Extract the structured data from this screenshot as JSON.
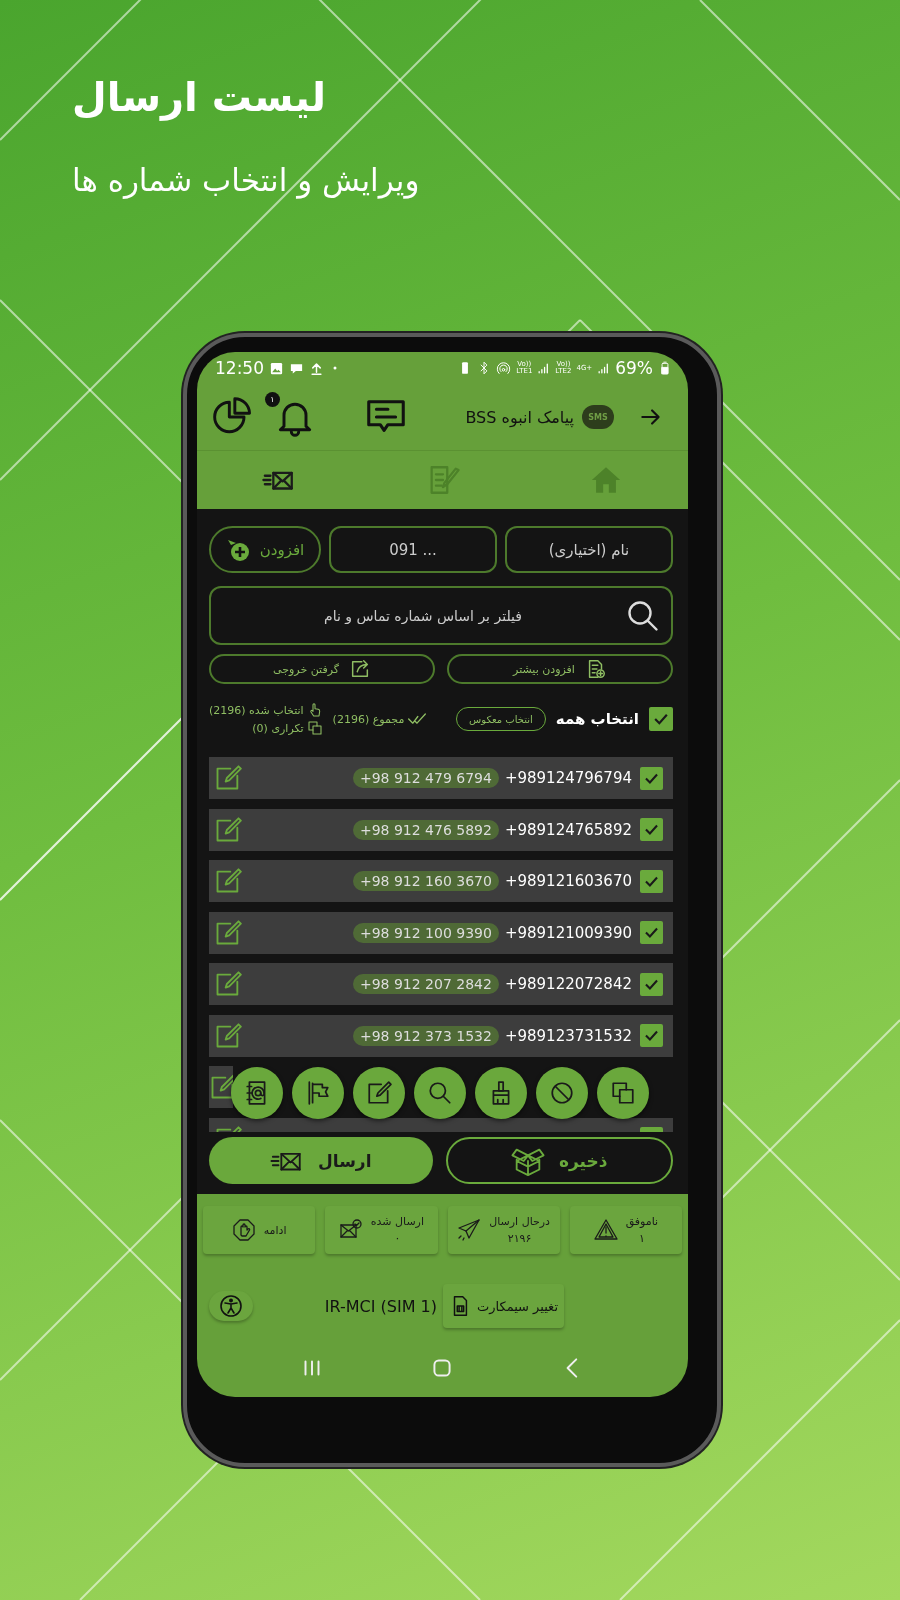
{
  "promo": {
    "title": "لیست ارسال",
    "subtitle": "ویرایش و انتخاب شماره ها"
  },
  "status_bar": {
    "time": "12:50",
    "battery": "69%",
    "sim1": {
      "volte": "Vo))",
      "label": "LTE1"
    },
    "sim2": {
      "volte": "Vo))",
      "label": "LTE2",
      "network": "4G+"
    }
  },
  "app_bar": {
    "title": "پیامک انبوه BSS",
    "logo": "SMS",
    "notification_count": "۱"
  },
  "tabs": [
    {
      "selected": false
    },
    {
      "selected": false
    },
    {
      "selected": true
    }
  ],
  "form": {
    "name_placeholder": "نام (اختیاری)",
    "number_placeholder": "091 ...",
    "add_button": "افزودن",
    "filter_placeholder": "فیلتر بر اساس شماره تماس و نام",
    "add_more_button": "افزودن بیشتر",
    "export_button": "گرفتن خروجی"
  },
  "selection": {
    "select_all": "انتخاب همه",
    "all_checked": true,
    "invert_button": "انتخاب معکوس",
    "total": "مجموع (2196)",
    "selected_count": "انتخاب شده (2196)",
    "duplicates": "تکراری (0)"
  },
  "numbers": [
    {
      "kind": "full",
      "number": "+989124796794",
      "formatted": "+98 912 479 6794",
      "checked": true
    },
    {
      "kind": "full",
      "number": "+989124765892",
      "formatted": "+98 912 476 5892",
      "checked": true
    },
    {
      "kind": "full",
      "number": "+989121603670",
      "formatted": "+98 912 160 3670",
      "checked": true
    },
    {
      "kind": "full",
      "number": "+989121009390",
      "formatted": "+98 912 100 9390",
      "checked": true
    },
    {
      "kind": "full",
      "number": "+989122072842",
      "formatted": "+98 912 207 2842",
      "checked": true
    },
    {
      "kind": "full",
      "number": "+989123731532",
      "formatted": "+98 912 373 1532",
      "checked": true
    },
    {
      "kind": "covered"
    },
    {
      "kind": "cut",
      "checked": true
    }
  ],
  "actions": {
    "send": "ارسال",
    "save": "ذخیره"
  },
  "stats": [
    {
      "kind": "failed",
      "label": "ناموفق",
      "value": "۱"
    },
    {
      "kind": "sending",
      "label": "درحال ارسال",
      "value": "۲۱۹۶"
    },
    {
      "kind": "sent",
      "label": "ارسال شده",
      "value": "۰"
    },
    {
      "kind": "resume",
      "label": "ادامه"
    }
  ],
  "sim": {
    "change_button": "تغییر سیمکارت",
    "carrier": "IR-MCI (SIM 1)"
  }
}
